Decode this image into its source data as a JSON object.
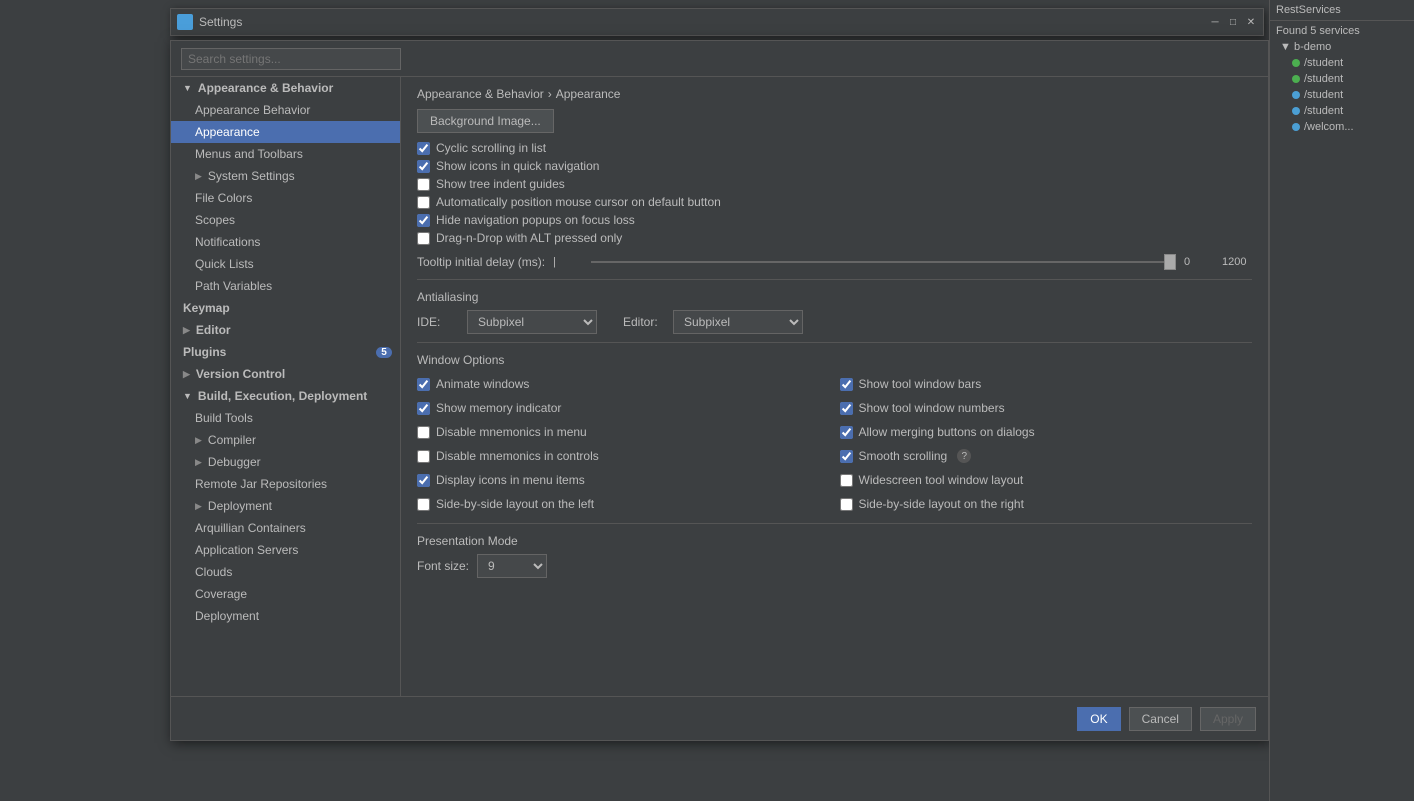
{
  "dialog": {
    "title": "Settings",
    "close_btn": "✕",
    "minimize_btn": "─",
    "maximize_btn": "□"
  },
  "search": {
    "placeholder": "Search settings..."
  },
  "breadcrumb": {
    "part1": "Appearance & Behavior",
    "sep": "›",
    "part2": "Appearance"
  },
  "sidebar": {
    "items": [
      {
        "label": "Appearance & Behavior",
        "level": 0,
        "expanded": true,
        "selected": false
      },
      {
        "label": "Appearance Behavior",
        "level": 1,
        "selected": false
      },
      {
        "label": "Appearance",
        "level": 1,
        "selected": true
      },
      {
        "label": "Menus and Toolbars",
        "level": 1,
        "selected": false
      },
      {
        "label": "System Settings",
        "level": 1,
        "expanded": false,
        "selected": false
      },
      {
        "label": "File Colors",
        "level": 1,
        "selected": false
      },
      {
        "label": "Scopes",
        "level": 1,
        "selected": false
      },
      {
        "label": "Notifications",
        "level": 1,
        "selected": false
      },
      {
        "label": "Quick Lists",
        "level": 1,
        "selected": false
      },
      {
        "label": "Path Variables",
        "level": 1,
        "selected": false
      },
      {
        "label": "Keymap",
        "level": 0,
        "selected": false
      },
      {
        "label": "Editor",
        "level": 0,
        "expanded": false,
        "selected": false
      },
      {
        "label": "Plugins",
        "level": 0,
        "badge": "5",
        "selected": false
      },
      {
        "label": "Version Control",
        "level": 0,
        "expanded": false,
        "selected": false
      },
      {
        "label": "Build, Execution, Deployment",
        "level": 0,
        "expanded": true,
        "selected": false
      },
      {
        "label": "Build Tools",
        "level": 1,
        "selected": false
      },
      {
        "label": "Compiler",
        "level": 1,
        "expanded": false,
        "selected": false
      },
      {
        "label": "Debugger",
        "level": 1,
        "expanded": false,
        "selected": false
      },
      {
        "label": "Remote Jar Repositories",
        "level": 1,
        "selected": false
      },
      {
        "label": "Deployment",
        "level": 1,
        "expanded": false,
        "selected": false
      },
      {
        "label": "Arquillian Containers",
        "level": 1,
        "selected": false
      },
      {
        "label": "Application Servers",
        "level": 1,
        "selected": false
      },
      {
        "label": "Clouds",
        "level": 1,
        "selected": false
      },
      {
        "label": "Coverage",
        "level": 1,
        "selected": false
      },
      {
        "label": "Deployment",
        "level": 1,
        "selected": false
      }
    ]
  },
  "content": {
    "background_btn": "Background Image...",
    "checkboxes_top": [
      {
        "label": "Cyclic scrolling in list",
        "checked": true
      },
      {
        "label": "Show icons in quick navigation",
        "checked": true
      },
      {
        "label": "Show tree indent guides",
        "checked": false
      },
      {
        "label": "Automatically position mouse cursor on default button",
        "checked": false
      },
      {
        "label": "Hide navigation popups on focus loss",
        "checked": true
      },
      {
        "label": "Drag-n-Drop with ALT pressed only",
        "checked": false
      }
    ],
    "slider": {
      "label": "Tooltip initial delay (ms):",
      "min": "0",
      "max": "1200"
    },
    "antialiasing": {
      "title": "Antialiasing",
      "ide_label": "IDE:",
      "ide_value": "Subpixel",
      "editor_label": "Editor:",
      "editor_value": "Subpixel"
    },
    "window_options": {
      "title": "Window Options",
      "checkboxes": [
        {
          "label": "Animate windows",
          "checked": true,
          "col": 0
        },
        {
          "label": "Show tool window bars",
          "checked": true,
          "col": 1
        },
        {
          "label": "Show memory indicator",
          "checked": true,
          "col": 0
        },
        {
          "label": "Show tool window numbers",
          "checked": true,
          "col": 1
        },
        {
          "label": "Disable mnemonics in menu",
          "checked": false,
          "col": 0
        },
        {
          "label": "Allow merging buttons on dialogs",
          "checked": true,
          "col": 1
        },
        {
          "label": "Disable mnemonics in controls",
          "checked": false,
          "col": 0
        },
        {
          "label": "Smooth scrolling",
          "checked": true,
          "col": 1
        },
        {
          "label": "Display icons in menu items",
          "checked": true,
          "col": 0
        },
        {
          "label": "Widescreen tool window layout",
          "checked": false,
          "col": 1
        },
        {
          "label": "Side-by-side layout on the left",
          "checked": false,
          "col": 0
        },
        {
          "label": "Side-by-side layout on the right",
          "checked": false,
          "col": 1
        }
      ]
    },
    "presentation": {
      "title": "Presentation Mode",
      "font_size_label": "Font size:",
      "font_size_value": "9"
    }
  },
  "footer": {
    "ok_label": "OK",
    "cancel_label": "Cancel",
    "apply_label": "Apply"
  },
  "services_panel": {
    "title": "Found 5 services",
    "b_demo": "b-demo",
    "services": [
      {
        "name": "/student",
        "color": "green"
      },
      {
        "name": "/student",
        "color": "green"
      },
      {
        "name": "/student",
        "color": "blue"
      },
      {
        "name": "/student",
        "color": "blue"
      },
      {
        "name": "/welcom...",
        "color": "blue"
      }
    ]
  }
}
